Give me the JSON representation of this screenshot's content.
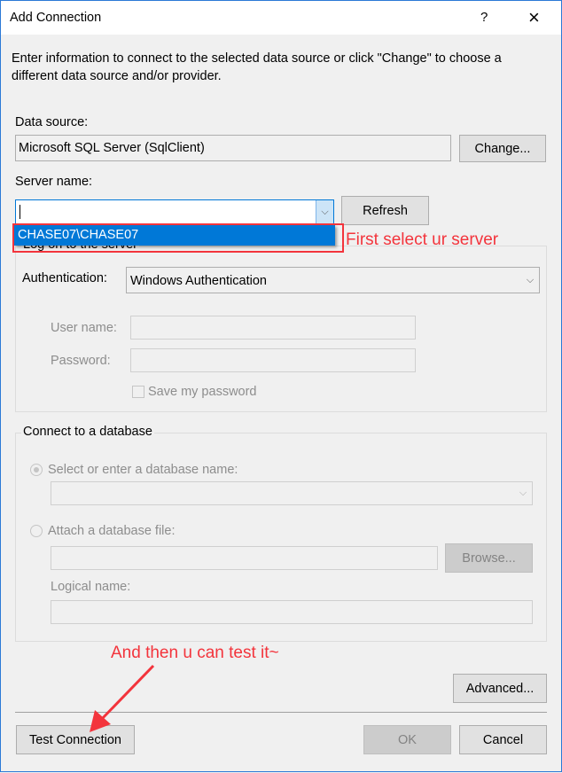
{
  "window": {
    "title": "Add Connection",
    "help": "?",
    "close": "×"
  },
  "intro": "Enter information to connect to the selected data source or click \"Change\" to choose a different data source and/or provider.",
  "data_source": {
    "label": "Data source:",
    "value": "Microsoft SQL Server (SqlClient)",
    "change": "Change..."
  },
  "server": {
    "label": "Server name:",
    "value": "",
    "refresh": "Refresh",
    "dropdown_items": [
      "CHASE07\\CHASE07"
    ]
  },
  "logon": {
    "legend": "Log on to the server",
    "auth_label": "Authentication:",
    "auth_value": "Windows Authentication",
    "user_label": "User name:",
    "password_label": "Password:",
    "save_password": "Save my password"
  },
  "database": {
    "legend": "Connect to a database",
    "select_option": "Select or enter a database name:",
    "attach_option": "Attach a database file:",
    "browse": "Browse...",
    "logical_label": "Logical name:"
  },
  "annotations": {
    "first": "First select ur server",
    "second": "And then u can test it~",
    "color": "#f3343c"
  },
  "buttons": {
    "advanced": "Advanced...",
    "test": "Test Connection",
    "ok": "OK",
    "cancel": "Cancel"
  }
}
